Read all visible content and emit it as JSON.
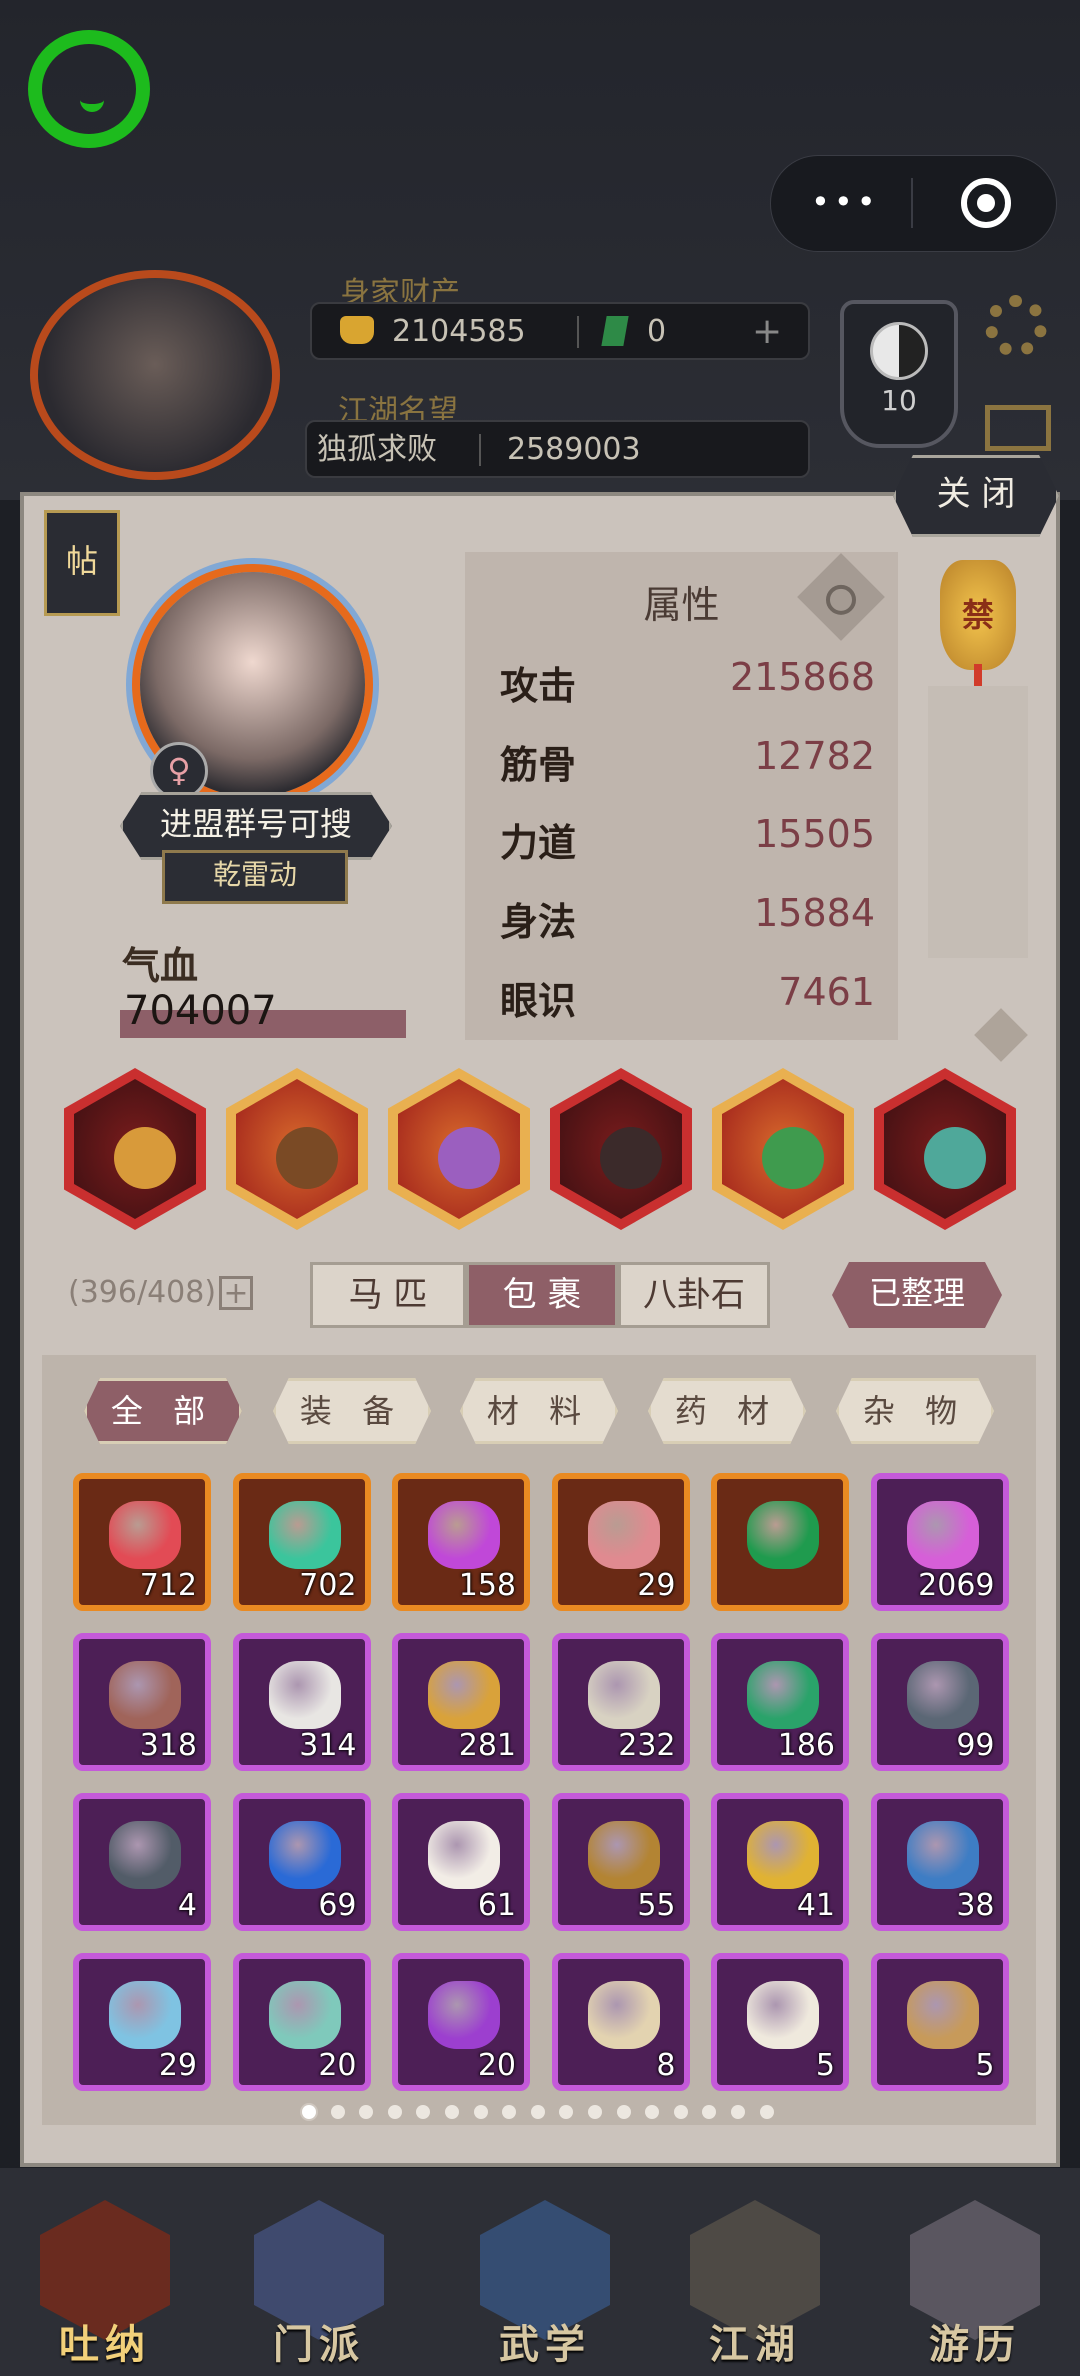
{
  "top": {
    "wealth_label": "身家财产",
    "gold": "2104585",
    "jade": "0",
    "fame_label": "江湖名望",
    "guild": "独孤求败",
    "fame": "2589003",
    "level_badge": "10",
    "hidden_name": "进盟群号可搜"
  },
  "panel": {
    "close": "关 闭",
    "tie_button": "帖",
    "gender_symbol": "♀",
    "name": "进盟群号可搜",
    "title": "乾雷动",
    "hp_label": "气血",
    "hp_value": "704007",
    "attr_title": "属性",
    "ban_badge": "禁",
    "attributes": [
      {
        "name": "攻击",
        "value": "215868"
      },
      {
        "name": "筋骨",
        "value": "12782"
      },
      {
        "name": "力道",
        "value": "15505"
      },
      {
        "name": "身法",
        "value": "15884"
      },
      {
        "name": "眼识",
        "value": "7461"
      }
    ]
  },
  "equipment": [
    {
      "icon": "gauntlet-icon",
      "frame": "red"
    },
    {
      "icon": "glove-icon",
      "frame": "orange"
    },
    {
      "icon": "ring-icon",
      "frame": "orange"
    },
    {
      "icon": "boots-icon",
      "frame": "red"
    },
    {
      "icon": "jade-pendant-icon",
      "frame": "orange"
    },
    {
      "icon": "mount-icon",
      "frame": "red"
    }
  ],
  "bag": {
    "capacity": "(396/408)",
    "plus": "+",
    "tabs": [
      "马 匹",
      "包 裹",
      "八卦石"
    ],
    "active_tab": 1,
    "sorted_button": "已整理",
    "categories": [
      "全 部",
      "装 备",
      "材 料",
      "药 材",
      "杂 物"
    ],
    "active_category": 0,
    "page_count": 17,
    "active_page": 0,
    "items": [
      {
        "count": "712",
        "rarity": "orange",
        "icon": "red-crystal-icon",
        "color": "#e24b55"
      },
      {
        "count": "702",
        "rarity": "orange",
        "icon": "green-crystal-icon",
        "color": "#3bc59c"
      },
      {
        "count": "158",
        "rarity": "orange",
        "icon": "purple-crystal-icon",
        "color": "#c048d8"
      },
      {
        "count": "29",
        "rarity": "orange",
        "icon": "pink-pills-icon",
        "color": "#e08a90"
      },
      {
        "count": "",
        "rarity": "orange",
        "icon": "jade-disc-icon",
        "color": "#1f9b4e"
      },
      {
        "count": "2069",
        "rarity": "purple",
        "icon": "purple-orb-icon",
        "color": "#d65fd8"
      },
      {
        "count": "318",
        "rarity": "purple",
        "icon": "dried-meat-icon",
        "color": "#a0645a"
      },
      {
        "count": "314",
        "rarity": "purple",
        "icon": "cotton-icon",
        "color": "#e8e6e3"
      },
      {
        "count": "281",
        "rarity": "purple",
        "icon": "red-booklet-icon",
        "color": "#d9a23a"
      },
      {
        "count": "232",
        "rarity": "purple",
        "icon": "paper-scroll-icon",
        "color": "#d8d2c2"
      },
      {
        "count": "186",
        "rarity": "purple",
        "icon": "emerald-ore-icon",
        "color": "#2aa36a"
      },
      {
        "count": "99",
        "rarity": "purple",
        "icon": "dark-ore-icon",
        "color": "#5b6775"
      },
      {
        "count": "4",
        "rarity": "purple",
        "icon": "dark-ore-icon",
        "color": "#525c68"
      },
      {
        "count": "69",
        "rarity": "purple",
        "icon": "sapphire-icon",
        "color": "#2a6ad6"
      },
      {
        "count": "61",
        "rarity": "purple",
        "icon": "pearl-icon",
        "color": "#f2ede6"
      },
      {
        "count": "55",
        "rarity": "purple",
        "icon": "armor-icon",
        "color": "#b38433"
      },
      {
        "count": "41",
        "rarity": "purple",
        "icon": "gold-shard-icon",
        "color": "#e0b233"
      },
      {
        "count": "38",
        "rarity": "purple",
        "icon": "blue-cloth-icon",
        "color": "#3e7dc4"
      },
      {
        "count": "29",
        "rarity": "purple",
        "icon": "ice-crystal-icon",
        "color": "#7fc3e2"
      },
      {
        "count": "20",
        "rarity": "purple",
        "icon": "jade-slip-icon",
        "color": "#7fc9bb"
      },
      {
        "count": "20",
        "rarity": "purple",
        "icon": "purple-pouch-icon",
        "color": "#9c3fcf"
      },
      {
        "count": "8",
        "rarity": "purple",
        "icon": "letter-icon",
        "color": "#e3d3b0"
      },
      {
        "count": "5",
        "rarity": "purple",
        "icon": "calligraphy-icon",
        "color": "#efe9dd"
      },
      {
        "count": "5",
        "rarity": "purple",
        "icon": "inkstone-icon",
        "color": "#c79a5a"
      }
    ]
  },
  "nav": [
    {
      "label": "吐纳",
      "icon": "gourd-icon"
    },
    {
      "label": "门派",
      "icon": "banner-icon"
    },
    {
      "label": "武学",
      "icon": "books-icon"
    },
    {
      "label": "江湖",
      "icon": "hat-icon"
    },
    {
      "label": "游历",
      "icon": "horse-icon"
    }
  ],
  "nav_active": 0
}
